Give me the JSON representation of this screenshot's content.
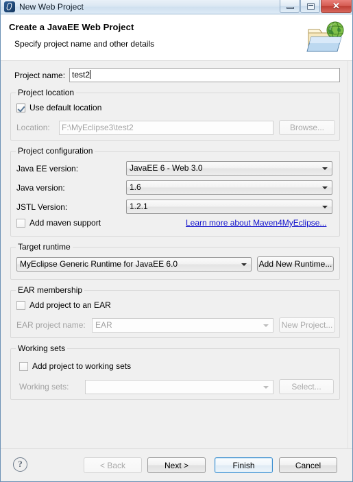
{
  "window": {
    "title": "New Web Project",
    "icon": "myeclipse-logo-icon",
    "minimize_label": "",
    "maximize_label": "",
    "close_label": "✕"
  },
  "header": {
    "title": "Create a JavaEE Web Project",
    "subtitle": "Specify project name and other details",
    "icon": "web-folder-globe-icon"
  },
  "form": {
    "project_name": {
      "label": "Project name:",
      "value": "test2",
      "placeholder": ""
    },
    "project_location": {
      "group_title": "Project location",
      "use_default_label": "Use default location",
      "use_default_checked": true,
      "location_label": "Location:",
      "location_value": "F:\\MyEclipse3\\test2",
      "browse_label": "Browse...",
      "browse_enabled": false
    },
    "project_configuration": {
      "group_title": "Project configuration",
      "javaee_version_label": "Java EE version:",
      "javaee_version_value": "JavaEE 6 - Web 3.0",
      "java_version_label": "Java version:",
      "java_version_value": "1.6",
      "jstl_version_label": "JSTL Version:",
      "jstl_version_value": "1.2.1",
      "maven_label": "Add maven support",
      "maven_checked": false,
      "maven_link": "Learn more about Maven4MyEclipse..."
    },
    "target_runtime": {
      "group_title": "Target runtime",
      "runtime_value": "MyEclipse Generic Runtime for JavaEE 6.0",
      "add_runtime_label": "Add New Runtime..."
    },
    "ear_membership": {
      "group_title": "EAR membership",
      "add_to_ear_label": "Add project to an EAR",
      "add_to_ear_checked": false,
      "ear_name_label": "EAR project name:",
      "ear_name_value": "EAR",
      "new_project_label": "New Project...",
      "enabled": false
    },
    "working_sets": {
      "group_title": "Working sets",
      "add_to_working_sets_label": "Add project to working sets",
      "add_to_working_sets_checked": false,
      "working_sets_label": "Working sets:",
      "working_sets_value": "",
      "select_label": "Select...",
      "enabled": false
    }
  },
  "buttonbar": {
    "help_label": "?",
    "back_label": "< Back",
    "back_enabled": false,
    "next_label": "Next >",
    "finish_label": "Finish",
    "cancel_label": "Cancel",
    "default_button": "Finish"
  },
  "colors": {
    "dialog_bg": "#f0f0f0",
    "header_bg": "#ffffff",
    "link": "#1111cc",
    "accent_focus": "#3c8fd0",
    "close_button": "#c0392b",
    "disabled_text": "#a2a2a2"
  }
}
